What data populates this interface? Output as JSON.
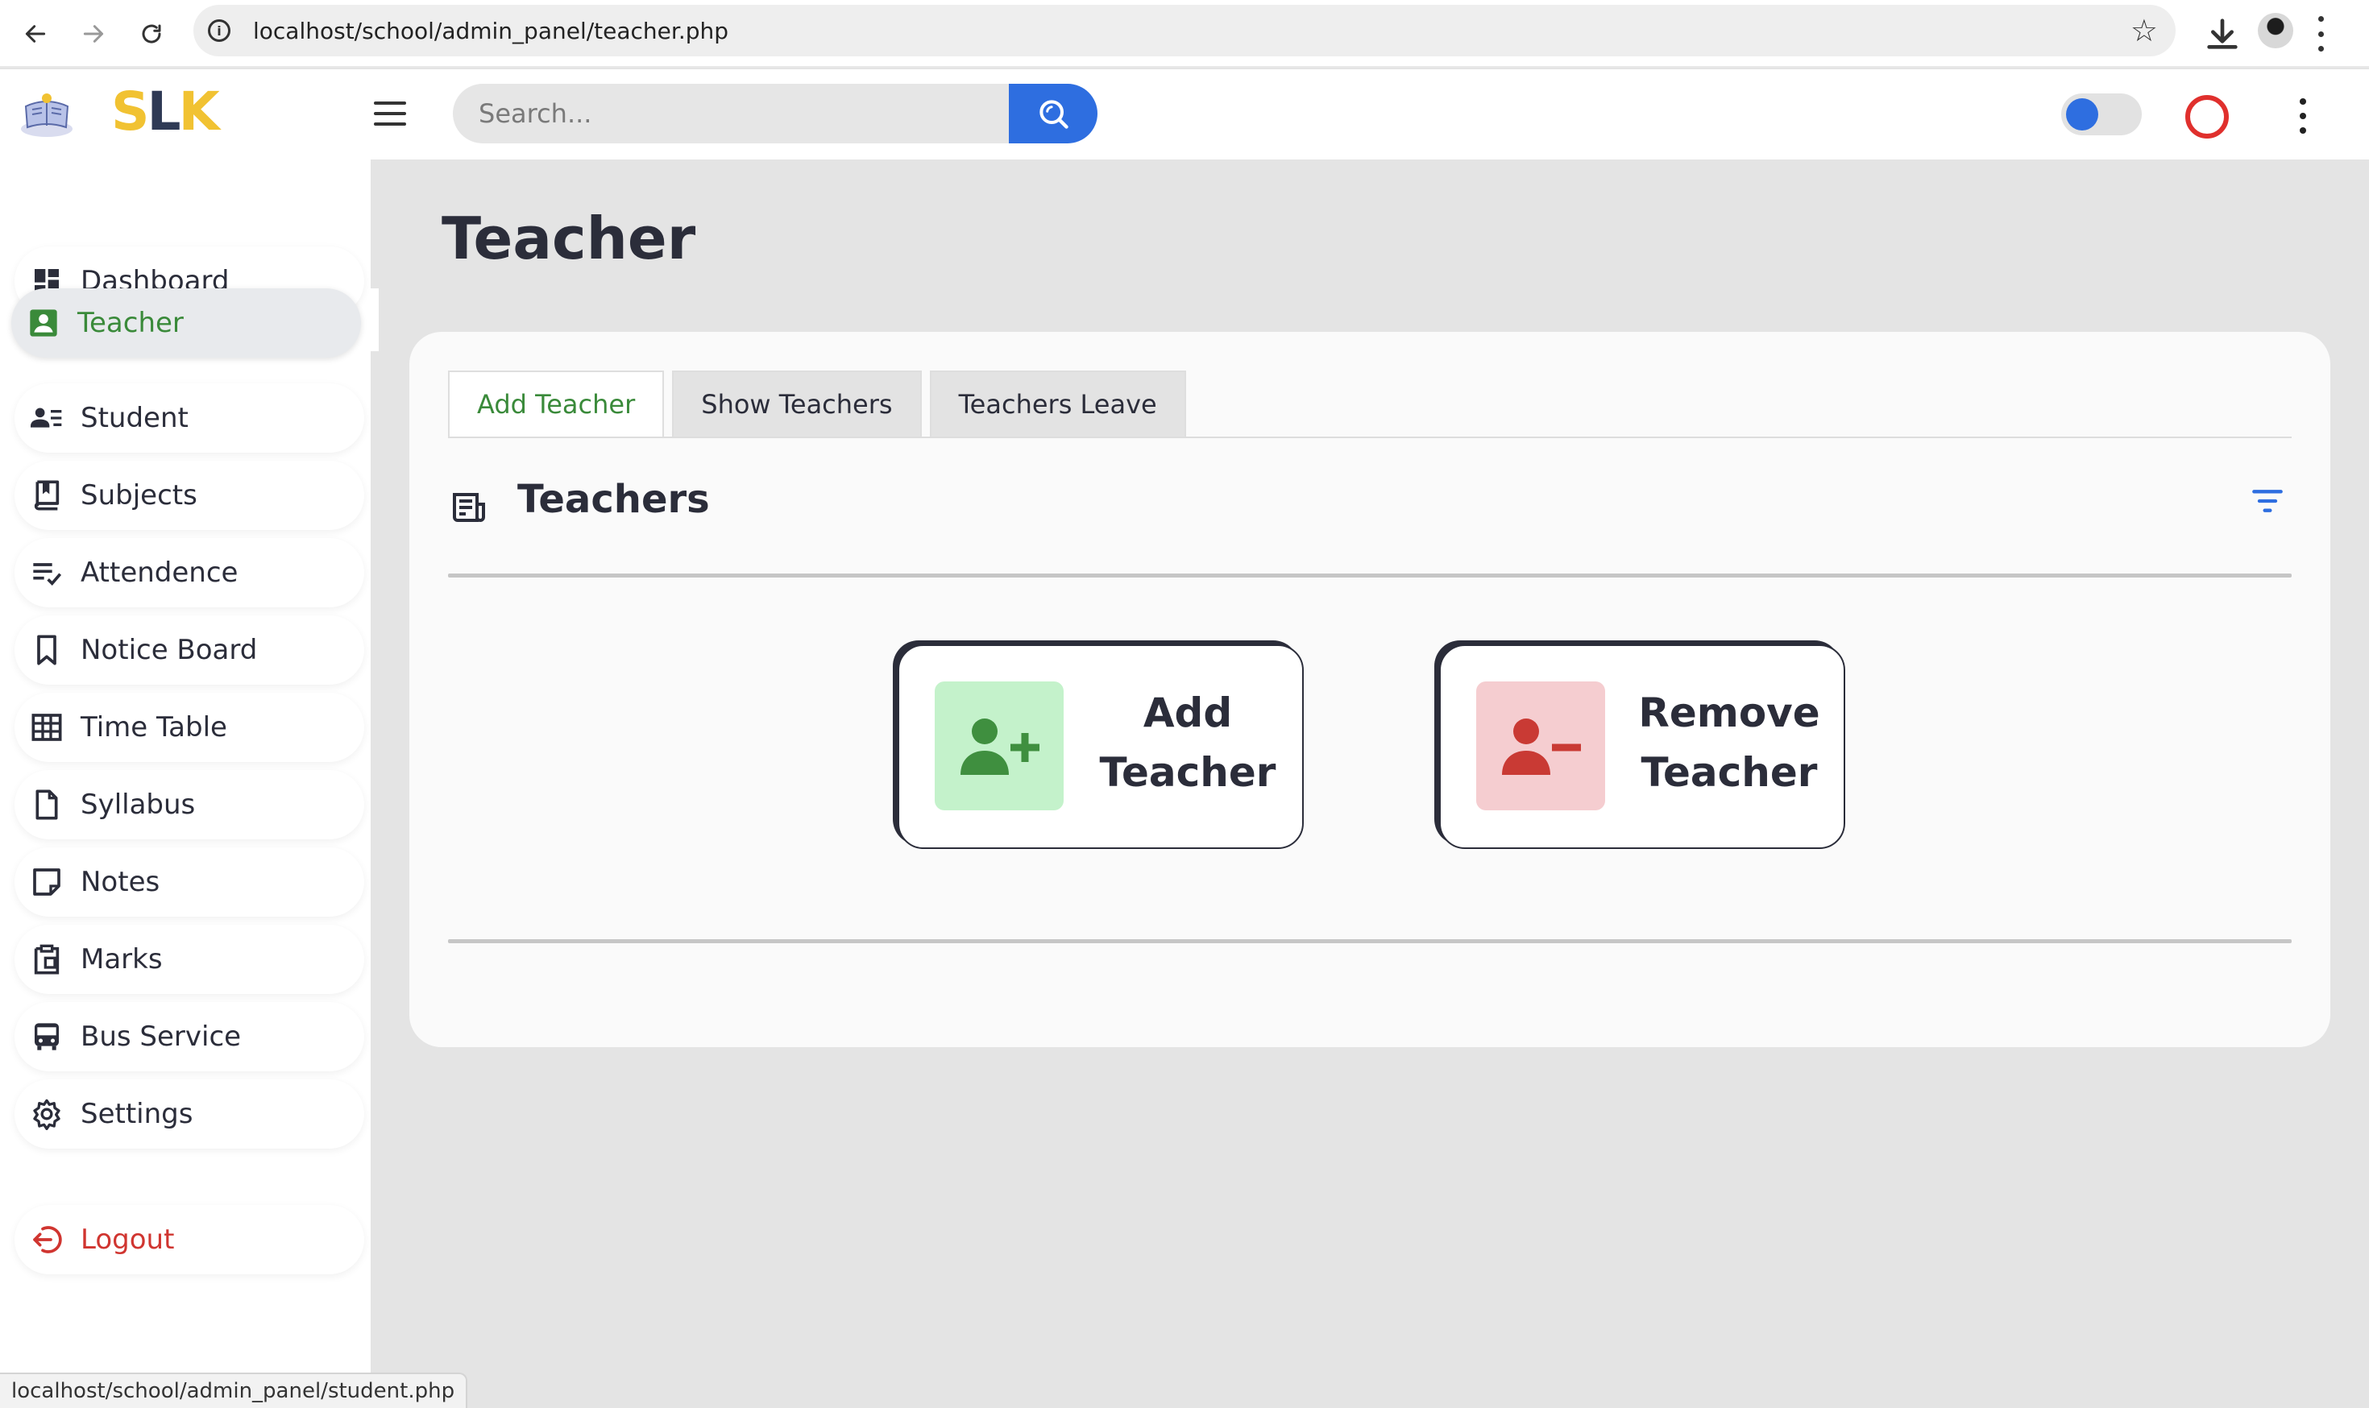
{
  "browser": {
    "url": "localhost/school/admin_panel/teacher.php",
    "status_url": "localhost/school/admin_panel/student.php"
  },
  "header": {
    "logo_s": "S",
    "logo_l": "L",
    "logo_k": "K",
    "search_placeholder": "Search...",
    "search_icon": "search-icon",
    "theme_toggle_on": false,
    "accent_color": "#2e6ee0",
    "ring_color": "#e0302d"
  },
  "sidebar": {
    "items": [
      {
        "label": "Dashboard",
        "icon": "dashboard-icon"
      },
      {
        "label": "Teacher",
        "icon": "teacher-icon",
        "active": true
      },
      {
        "label": "Student",
        "icon": "student-icon"
      },
      {
        "label": "Subjects",
        "icon": "book-icon"
      },
      {
        "label": "Attendence",
        "icon": "checklist-icon"
      },
      {
        "label": "Notice Board",
        "icon": "bookmark-icon"
      },
      {
        "label": "Time Table",
        "icon": "table-icon"
      },
      {
        "label": "Syllabus",
        "icon": "file-icon"
      },
      {
        "label": "Notes",
        "icon": "note-icon"
      },
      {
        "label": "Marks",
        "icon": "clipboard-icon"
      },
      {
        "label": "Bus Service",
        "icon": "bus-icon"
      },
      {
        "label": "Settings",
        "icon": "gear-icon"
      }
    ],
    "logout": {
      "label": "Logout",
      "icon": "logout-icon",
      "color": "#d03530"
    },
    "active_color": "#3a8a3a"
  },
  "main": {
    "page_title": "Teacher",
    "tabs": [
      {
        "label": "Add Teacher",
        "active": true
      },
      {
        "label": "Show Teachers"
      },
      {
        "label": "Teachers Leave"
      }
    ],
    "section_title": "Teachers",
    "actions": [
      {
        "line1": "Add",
        "line2": "Teacher",
        "icon": "person-add-icon",
        "bg": "#c4f2cb",
        "fg": "#3f8f3f"
      },
      {
        "line1": "Remove",
        "line2": "Teacher",
        "icon": "person-remove-icon",
        "bg": "#f5cdd0",
        "fg": "#c93a34"
      }
    ]
  }
}
